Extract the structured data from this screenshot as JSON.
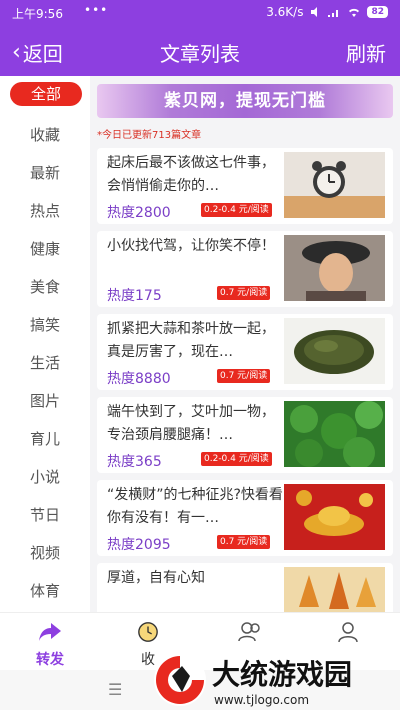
{
  "status_bar": {
    "time": "上午9:56",
    "dots": "•••",
    "speed": "3.6K/s",
    "battery": "82"
  },
  "header": {
    "back_label": "返回",
    "title": "文章列表",
    "refresh_label": "刷新"
  },
  "sidebar": {
    "items": [
      {
        "label": "全部",
        "active": true
      },
      {
        "label": "收藏"
      },
      {
        "label": "最新"
      },
      {
        "label": "热点"
      },
      {
        "label": "健康"
      },
      {
        "label": "美食"
      },
      {
        "label": "搞笑"
      },
      {
        "label": "生活"
      },
      {
        "label": "图片"
      },
      {
        "label": "育儿"
      },
      {
        "label": "小说"
      },
      {
        "label": "节日"
      },
      {
        "label": "视频"
      },
      {
        "label": "体育"
      }
    ]
  },
  "banner": {
    "text": "紫贝网，提现无门槛"
  },
  "updated_note": "*今日已更新713篇文章",
  "articles": [
    {
      "title": "起床后最不该做这七件事，会悄悄偷走你的…",
      "heat": "热度2800",
      "price": "0.2-0.4 元/阅读",
      "image": "alarm-clock-image"
    },
    {
      "title": "小伙找代驾，让你笑不停！",
      "heat": "热度175",
      "price": "0.7 元/阅读",
      "image": "person-hat-image"
    },
    {
      "title": "抓紧把大蒜和茶叶放一起，真是厉害了，现在…",
      "heat": "热度8880",
      "price": "0.7 元/阅读",
      "image": "tea-leaves-image"
    },
    {
      "title": "端午快到了，艾叶加一物，专治颈肩腰腿痛！…",
      "heat": "热度365",
      "price": "0.2-0.4 元/阅读",
      "image": "mugwort-image"
    },
    {
      "title": "“发横财”的七种征兆?快看看你有没有！有一…",
      "heat": "热度2095",
      "price": "0.7 元/阅读",
      "image": "gold-ingot-image"
    },
    {
      "title": "厚道，自有心知",
      "heat": "",
      "price": "",
      "image": "autumn-leaves-image"
    }
  ],
  "bottom_nav": [
    {
      "label": "转发",
      "icon": "share-icon",
      "active": true
    },
    {
      "label": "收",
      "icon": "clock-icon"
    },
    {
      "label": "",
      "icon": "users-icon"
    },
    {
      "label": "",
      "icon": "user-icon"
    }
  ],
  "watermark": {
    "brand": "大统游戏园",
    "url": "www.tjlogo.com"
  },
  "colors": {
    "brand": "#8d3fe0",
    "accent": "#e8291f",
    "heat": "#7b3fc7"
  }
}
